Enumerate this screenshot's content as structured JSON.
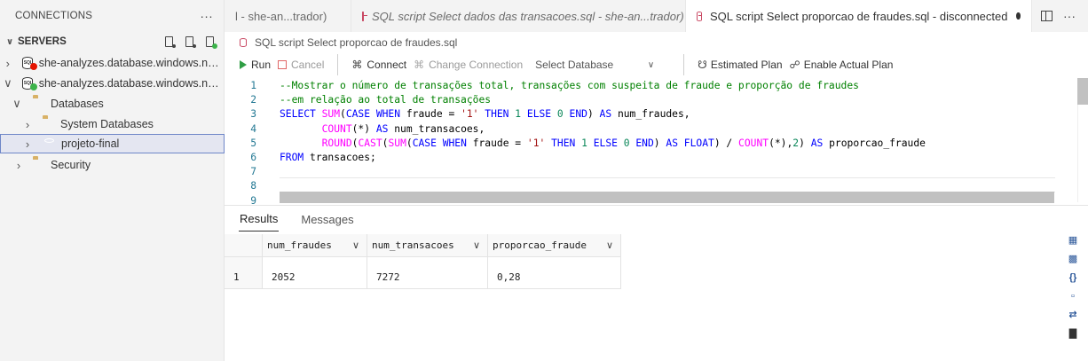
{
  "sidebar": {
    "header_title": "CONNECTIONS",
    "more_label": "···",
    "servers_label": "SERVERS",
    "servers": [
      {
        "label": "she-analyzes.database.windows.net,...",
        "status_color": "#e51400",
        "expanded": false
      },
      {
        "label": "she-analyzes.database.windows.net,...",
        "status_color": "#3cb34a",
        "expanded": true
      }
    ],
    "databases_label": "Databases",
    "system_databases_label": "System Databases",
    "project_label": "projeto-final",
    "security_label": "Security"
  },
  "tabs": [
    {
      "label": "l - she-an...trador)",
      "italic": false
    },
    {
      "label": "SQL script Select dados das transacoes.sql - she-an...trador)",
      "italic": true
    },
    {
      "label": "SQL script Select proporcao de fraudes.sql - disconnected",
      "italic": false,
      "active": true
    }
  ],
  "breadcrumb": "SQL script Select proporcao de fraudes.sql",
  "toolbar": {
    "run": "Run",
    "cancel": "Cancel",
    "connect": "Connect",
    "change_connection": "Change Connection",
    "select_database": "Select Database",
    "estimated_plan": "Estimated Plan",
    "enable_actual_plan": "Enable Actual Plan"
  },
  "editor": {
    "line_numbers": [
      "1",
      "2",
      "3",
      "4",
      "5",
      "6",
      "7",
      "8",
      "9"
    ],
    "code": [
      [
        [
          "cm",
          "--Mostrar o número de transações total, transações com suspeita de fraude e proporção de fraudes"
        ]
      ],
      [
        [
          "cm",
          "--em relação ao total de transações"
        ]
      ],
      [
        [
          "kw",
          "SELECT "
        ],
        [
          "fnc",
          "SUM"
        ],
        [
          "",
          "("
        ],
        [
          "kw",
          "CASE WHEN "
        ],
        [
          "",
          "fraude = "
        ],
        [
          "str",
          "'1'"
        ],
        [
          "kw",
          " THEN "
        ],
        [
          "num",
          "1"
        ],
        [
          "kw",
          " ELSE "
        ],
        [
          "num",
          "0"
        ],
        [
          "kw",
          " END"
        ],
        [
          "",
          ") "
        ],
        [
          "kw",
          "AS"
        ],
        [
          "",
          " num_fraudes,"
        ]
      ],
      [
        [
          "",
          "       "
        ],
        [
          "fnc",
          "COUNT"
        ],
        [
          "",
          "(*) "
        ],
        [
          "kw",
          "AS"
        ],
        [
          "",
          " num_transacoes,"
        ]
      ],
      [
        [
          "",
          "       "
        ],
        [
          "fnc",
          "ROUND"
        ],
        [
          "",
          "("
        ],
        [
          "fnc",
          "CAST"
        ],
        [
          "",
          "("
        ],
        [
          "fnc",
          "SUM"
        ],
        [
          "",
          "("
        ],
        [
          "kw",
          "CASE WHEN "
        ],
        [
          "",
          "fraude = "
        ],
        [
          "str",
          "'1'"
        ],
        [
          "kw",
          " THEN "
        ],
        [
          "num",
          "1"
        ],
        [
          "kw",
          " ELSE "
        ],
        [
          "num",
          "0"
        ],
        [
          "kw",
          " END"
        ],
        [
          "",
          ") "
        ],
        [
          "kw",
          "AS FLOAT"
        ],
        [
          "",
          ") / "
        ],
        [
          "fnc",
          "COUNT"
        ],
        [
          "",
          "(*),"
        ],
        [
          "num",
          "2"
        ],
        [
          "",
          ") "
        ],
        [
          "kw",
          "AS"
        ],
        [
          "",
          " proporcao_fraude"
        ]
      ],
      [
        [
          "kw",
          "FROM"
        ],
        [
          "",
          " transacoes;"
        ]
      ],
      [],
      [],
      []
    ]
  },
  "results": {
    "tabs": [
      "Results",
      "Messages"
    ],
    "columns": [
      "num_fraudes",
      "num_transacoes",
      "proporcao_fraude"
    ],
    "rows": [
      {
        "index": "1",
        "cells": [
          "2052",
          "7272",
          "0,28"
        ]
      }
    ]
  },
  "colors": {
    "accent_blue": "#0000ff",
    "comment_green": "#008000",
    "run_green": "#2f9e44",
    "tab_db_icon": "#c94863"
  }
}
